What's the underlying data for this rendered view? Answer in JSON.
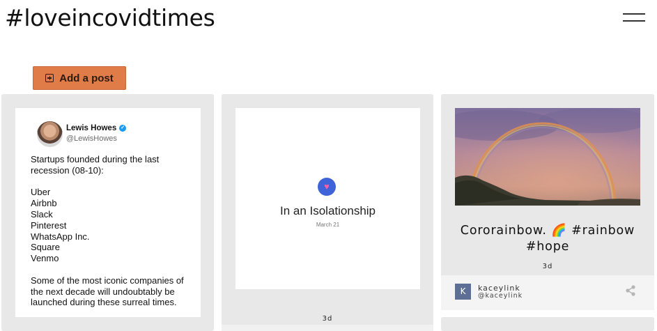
{
  "site": {
    "title": "#loveincovidtimes"
  },
  "header": {
    "menu_icon": "hamburger-menu-icon"
  },
  "toolbar": {
    "add_post_label": "Add a post",
    "add_post_icon": "plus-square-icon",
    "accent": "#e07c47"
  },
  "posts": [
    {
      "type": "tweet-image",
      "tweet": {
        "name": "Lewis Howes",
        "handle": "@LewisHowes",
        "lines": [
          "Startups founded during the last recession (08-10):",
          "",
          "Uber",
          "Airbnb",
          "Slack",
          "Pinterest",
          "WhatsApp Inc.",
          "Square",
          "Venmo",
          "",
          "Some of the most iconic companies of the next decade will undoubtably be launched during these surreal times."
        ]
      }
    },
    {
      "type": "image",
      "image_title": "In an Isolationship",
      "image_date": "March 21",
      "time": "3d"
    },
    {
      "type": "image",
      "caption": "Cororainbow. 🌈 #rainbow #hope",
      "time": "3d",
      "author": {
        "initial": "K",
        "name": "kaceylink",
        "handle": "@kaceylink"
      },
      "share_icon": "share-icon"
    }
  ]
}
